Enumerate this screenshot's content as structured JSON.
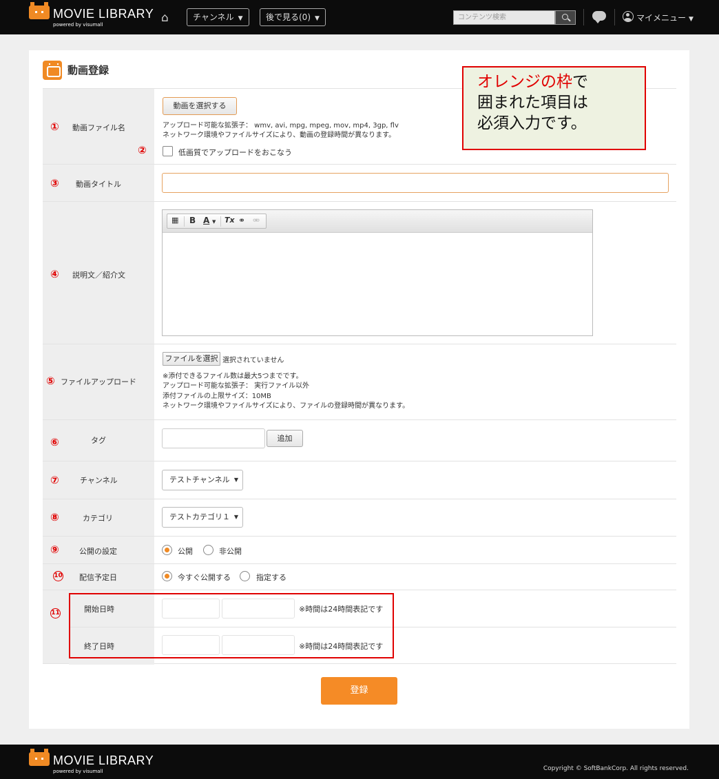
{
  "header": {
    "logo_title": "MOVIE LIBRARY",
    "logo_sub": "powered by visumall",
    "nav_channel": "チャンネル",
    "nav_watch_later": "後で見る(0)",
    "search_placeholder": "コンテンツ検索",
    "my_menu": "マイメニュー",
    "caret": "▼"
  },
  "page": {
    "title": "動画登録"
  },
  "note": {
    "highlight": "オレンジの枠",
    "line1_rest": "で",
    "line2": "囲まれた項目は",
    "line3": "必須入力です。"
  },
  "numbers": [
    "①",
    "②",
    "③",
    "④",
    "⑤",
    "⑥",
    "⑦",
    "⑧",
    "⑨",
    "10",
    "11"
  ],
  "form": {
    "video_file": {
      "label": "動画ファイル名",
      "button": "動画を選択する",
      "ext_line": "アップロード可能な拡張子： wmv, avi, mpg, mpeg, mov, mp4, 3gp, flv",
      "net_line": "ネットワーク環境やファイルサイズにより、動画の登録時間が異なります。",
      "low_quality": "低画質でアップロードをおこなう"
    },
    "video_title": {
      "label": "動画タイトル",
      "value": ""
    },
    "description": {
      "label": "説明文／紹介文",
      "toolbar": [
        "▦",
        "B",
        "A",
        "Tx",
        "⚭",
        "⚮"
      ]
    },
    "file_upload": {
      "label": "ファイルアップロード",
      "button": "ファイルを選択",
      "status": "選択されていません",
      "lines": [
        "※添付できるファイル数は最大5つまでです。",
        "アップロード可能な拡張子： 実行ファイル以外",
        "添付ファイルの上限サイズ：10MB",
        "ネットワーク環境やファイルサイズにより、ファイルの登録時間が異なります。"
      ]
    },
    "tag": {
      "label": "タグ",
      "value": "",
      "add_button": "追加"
    },
    "channel": {
      "label": "チャンネル",
      "selected": "テストチャンネル"
    },
    "category": {
      "label": "カテゴリ",
      "selected": "テストカテゴリ１"
    },
    "visibility": {
      "label": "公開の設定",
      "options": [
        "公開",
        "非公開"
      ],
      "selected": "公開"
    },
    "schedule": {
      "label": "配信予定日",
      "options": [
        "今すぐ公開する",
        "指定する"
      ],
      "selected": "今すぐ公開する"
    },
    "start": {
      "label": "開始日時",
      "note": "※時間は24時間表記です"
    },
    "end": {
      "label": "終了日時",
      "note": "※時間は24時間表記です"
    },
    "submit": "登録"
  },
  "footer": {
    "logo_title": "MOVIE LIBRARY",
    "logo_sub": "powered by visumall",
    "copyright": "Copyright © SoftBankCorp. All rights reserved."
  },
  "colors": {
    "accent": "#f08a24",
    "annotation": "#e00000",
    "header_bg": "#0c0c0c"
  }
}
